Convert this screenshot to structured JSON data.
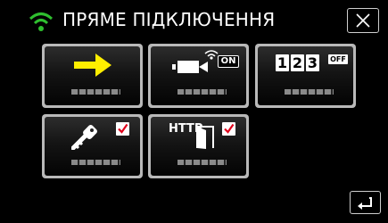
{
  "header": {
    "title": "ПРЯМЕ ПІДКЛЮЧЕННЯ",
    "wifi_icon": "wifi-icon",
    "close_icon": "close-icon"
  },
  "tiles": [
    {
      "name": "connect",
      "icon": "arrow-right-icon"
    },
    {
      "name": "video-camera-on",
      "icon": "video-camera-wifi-icon",
      "badge": "ON"
    },
    {
      "name": "counter-off",
      "digits": [
        "1",
        "2",
        "3"
      ],
      "badge": "OFF"
    },
    {
      "name": "key-password",
      "icon": "key-icon",
      "checked": true
    },
    {
      "name": "http-door",
      "icon": "door-icon",
      "text": "HTTP",
      "checked": true
    }
  ],
  "footer": {
    "back_icon": "return-arrow-icon"
  },
  "colors": {
    "accent_green": "#2fbf2f",
    "arrow_yellow": "#ffee00",
    "check_red": "#e0001b",
    "tile_border": "#b9b9b9"
  }
}
